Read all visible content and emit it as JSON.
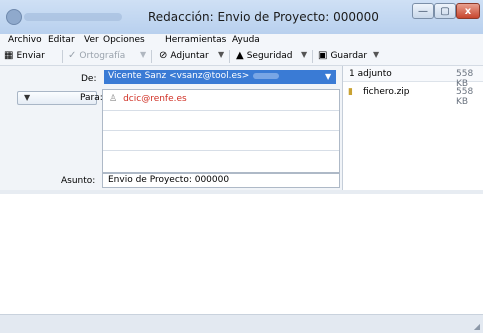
{
  "window": {
    "title": "Redacción: Envio de Proyecto: 000000",
    "controls": {
      "minimize": "—",
      "maximize": "▢",
      "close": "x"
    }
  },
  "menu": [
    "Archivo",
    "Editar",
    "Ver",
    "Opciones",
    "Herramientas",
    "Ayuda"
  ],
  "toolbar": {
    "send": "Enviar",
    "spelling": "Ortografía",
    "attach": "Adjuntar",
    "security": "Seguridad",
    "save": "Guardar",
    "dropdown_glyph": "▼"
  },
  "compose": {
    "from_label": "De:",
    "from_value": "Vicente Sanz <vsanz@tool.es>",
    "to_type": "Para:",
    "recipients": [
      "dcic@renfe.es"
    ],
    "subject_label": "Asunto:",
    "subject_value": "Envio de Proyecto: 000000"
  },
  "attachments": {
    "summary": "1 adjunto",
    "total_size": "558 KB",
    "files": [
      {
        "name": "fichero.zip",
        "size": "558 KB"
      }
    ]
  },
  "colors": {
    "accent": "#3a7bd5",
    "recipient_text": "#d03025",
    "title_bar": "#c6daf2"
  },
  "icons": [
    "app-icon",
    "send-icon",
    "spellcheck-icon",
    "paperclip-icon",
    "lock-icon",
    "floppy-disk-icon",
    "person-icon",
    "zip-file-icon"
  ]
}
